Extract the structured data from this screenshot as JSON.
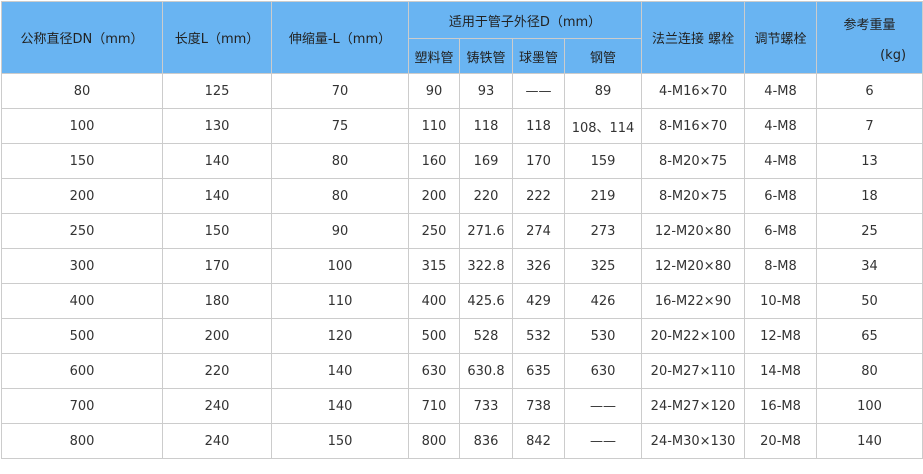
{
  "headers": {
    "dn": "公称直径DN（mm）",
    "length": "长度L（mm）",
    "stretch": "伸缩量-L（mm）",
    "od_group": "适用于管子外径D（mm）",
    "plastic": "塑料管",
    "cast_iron": "铸铁管",
    "ductile": "球墨管",
    "steel": "钢管",
    "flange_bolt": "法兰连接 螺栓",
    "adjust_bolt": "调节螺栓",
    "weight": "参考重量",
    "weight_unit": "(kg)"
  },
  "rows": [
    {
      "dn": "80",
      "length": "125",
      "stretch": "70",
      "plastic": "90",
      "cast_iron": "93",
      "ductile": "——",
      "steel": "89",
      "flange_bolt": "4-M16×70",
      "adjust_bolt": "4-M8",
      "weight": "6"
    },
    {
      "dn": "100",
      "length": "130",
      "stretch": "75",
      "plastic": "110",
      "cast_iron": "118",
      "ductile": "118",
      "steel": "108、114",
      "flange_bolt": "8-M16×70",
      "adjust_bolt": "4-M8",
      "weight": "7"
    },
    {
      "dn": "150",
      "length": "140",
      "stretch": "80",
      "plastic": "160",
      "cast_iron": "169",
      "ductile": "170",
      "steel": "159",
      "flange_bolt": "8-M20×75",
      "adjust_bolt": "4-M8",
      "weight": "13"
    },
    {
      "dn": "200",
      "length": "140",
      "stretch": "80",
      "plastic": "200",
      "cast_iron": "220",
      "ductile": "222",
      "steel": "219",
      "flange_bolt": "8-M20×75",
      "adjust_bolt": "6-M8",
      "weight": "18"
    },
    {
      "dn": "250",
      "length": "150",
      "stretch": "90",
      "plastic": "250",
      "cast_iron": "271.6",
      "ductile": "274",
      "steel": "273",
      "flange_bolt": "12-M20×80",
      "adjust_bolt": "6-M8",
      "weight": "25"
    },
    {
      "dn": "300",
      "length": "170",
      "stretch": "100",
      "plastic": "315",
      "cast_iron": "322.8",
      "ductile": "326",
      "steel": "325",
      "flange_bolt": "12-M20×80",
      "adjust_bolt": "8-M8",
      "weight": "34"
    },
    {
      "dn": "400",
      "length": "180",
      "stretch": "110",
      "plastic": "400",
      "cast_iron": "425.6",
      "ductile": "429",
      "steel": "426",
      "flange_bolt": "16-M22×90",
      "adjust_bolt": "10-M8",
      "weight": "50"
    },
    {
      "dn": "500",
      "length": "200",
      "stretch": "120",
      "plastic": "500",
      "cast_iron": "528",
      "ductile": "532",
      "steel": "530",
      "flange_bolt": "20-M22×100",
      "adjust_bolt": "12-M8",
      "weight": "65"
    },
    {
      "dn": "600",
      "length": "220",
      "stretch": "140",
      "plastic": "630",
      "cast_iron": "630.8",
      "ductile": "635",
      "steel": "630",
      "flange_bolt": "20-M27×110",
      "adjust_bolt": "14-M8",
      "weight": "80"
    },
    {
      "dn": "700",
      "length": "240",
      "stretch": "140",
      "plastic": "710",
      "cast_iron": "733",
      "ductile": "738",
      "steel": "——",
      "flange_bolt": "24-M27×120",
      "adjust_bolt": "16-M8",
      "weight": "100"
    },
    {
      "dn": "800",
      "length": "240",
      "stretch": "150",
      "plastic": "800",
      "cast_iron": "836",
      "ductile": "842",
      "steel": "——",
      "flange_bolt": "24-M30×130",
      "adjust_bolt": "20-M8",
      "weight": "140"
    }
  ]
}
